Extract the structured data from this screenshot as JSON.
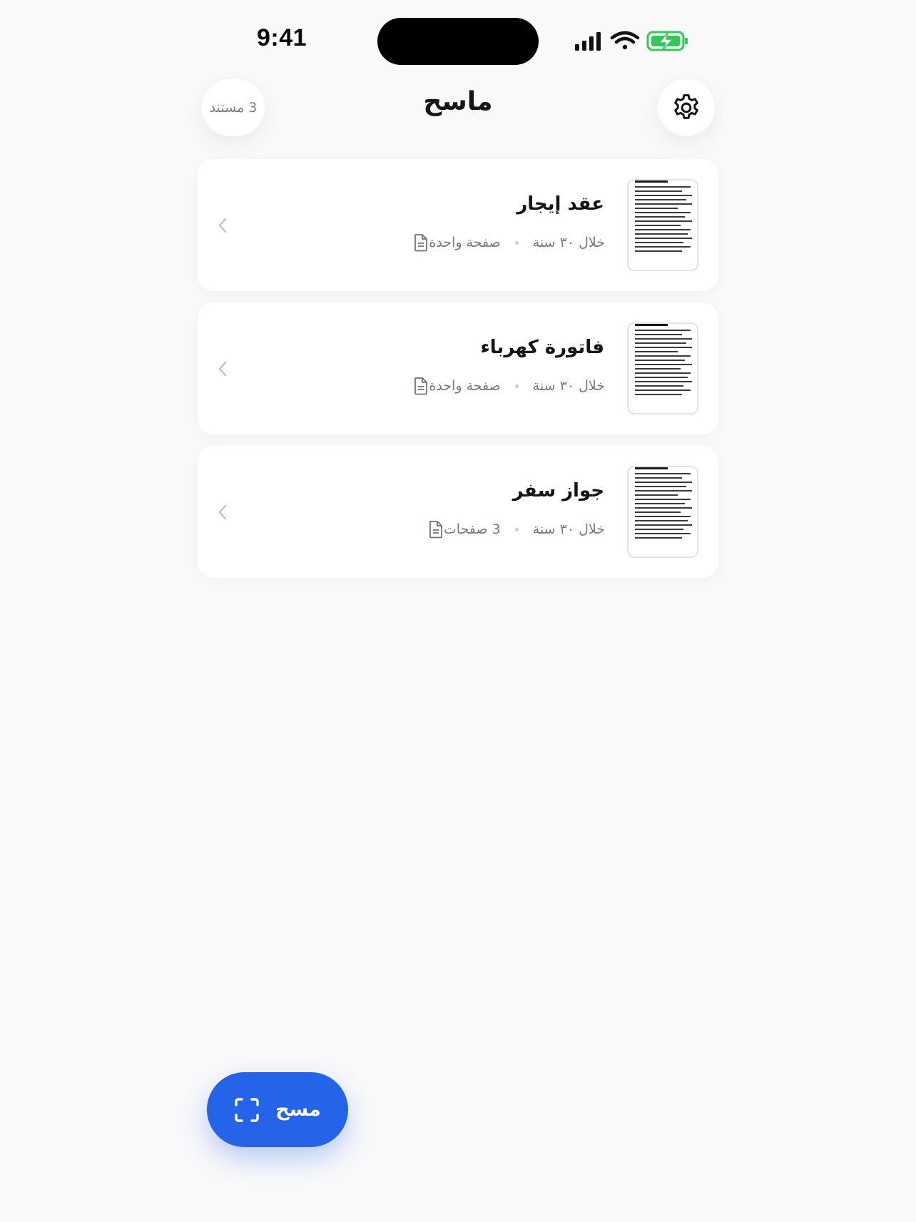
{
  "status_bar": {
    "time": "9:41",
    "icons": [
      "cellular-signal-icon",
      "wifi-icon",
      "battery-charging-icon"
    ],
    "battery_color": "#34c759"
  },
  "header": {
    "title": "ماسح",
    "doc_count": "3 مستند",
    "settings_icon": "gear-icon"
  },
  "documents": [
    {
      "title": "عقد إيجار",
      "pages": "صفحة واحدة",
      "time": "خلال ٣٠ سنة"
    },
    {
      "title": "فاتورة كهرباء",
      "pages": "صفحة واحدة",
      "time": "خلال ٣٠ سنة"
    },
    {
      "title": "جواز سفر",
      "pages": "3 صفحات",
      "time": "خلال ٣٠ سنة"
    }
  ],
  "fab": {
    "label": "مسح",
    "icon": "scan-frame-icon",
    "color": "#2563e8"
  }
}
